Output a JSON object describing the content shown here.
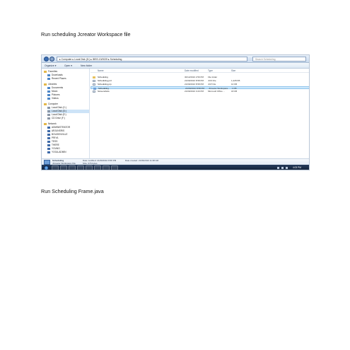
{
  "captions": {
    "first": "Run scheduling Jcreator Workspace file",
    "second": "Run Scheduling Frame.java"
  },
  "explorer": {
    "address_path": "▸ Computer ▸ Local Disk (D:) ▸ IBSS-13/0025 ▸ Scheduling",
    "search_placeholder": "Search Scheduling",
    "commands": [
      "Organize ▾",
      "Open ▾",
      "New folder"
    ],
    "nav": {
      "favorites": "Favorites",
      "favorites_items": [
        "Downloads",
        "Recent Places"
      ],
      "libraries": "Libraries",
      "libraries_items": [
        "Documents",
        "Music",
        "Pictures",
        "Videos"
      ],
      "computer": "Computer",
      "computer_items": [
        "Local Disk (C:)",
        "Local Disk (D:)",
        "Local Disk (E:)",
        "CD Drive (F:)"
      ],
      "network": "Network",
      "network_items": [
        "ADMINISTRATOR",
        "ARJUNSRIS",
        "BOUGENVILLE",
        "PRIYA",
        "TESS",
        "THERE",
        "YOUNG",
        "YOGA-ADMIN"
      ]
    },
    "columns": [
      "Name",
      "Date modified",
      "Type",
      "Size"
    ],
    "files": [
      {
        "name": "Scheduling",
        "date": "30/12/2010 2:59 PM",
        "type": "File folder",
        "size": "",
        "icon": "folder-icon"
      },
      {
        "name": "Scheduling.jcd",
        "date": "21/09/2010 8:58 PM",
        "type": "JCD File",
        "size": "1,228 KB",
        "icon": "file-icon"
      },
      {
        "name": "Scheduling.jcp",
        "date": "21/09/2010 8:58 PM",
        "type": "JCP File",
        "size": "10 KB",
        "icon": "file-icon"
      },
      {
        "name": "Scheduling",
        "date": "21/09/2010 8:58 PM",
        "type": "JCreator Workspace",
        "size": "1 KB",
        "icon": "java-icon",
        "selected": true
      },
      {
        "name": "Screenshots",
        "date": "21/09/2010 3:20 PM",
        "type": "Microsoft Office ...",
        "size": "18 KB",
        "icon": "file-icon"
      }
    ],
    "details": {
      "name": "Scheduling",
      "type": "JCreator Workspace File",
      "date_modified": "Date modified: 21/09/2010 8:58 PM",
      "size": "Size: 376 bytes",
      "date_created": "Date created: 21/09/2010 11:38 AM"
    },
    "clock": "4:03 PM"
  }
}
